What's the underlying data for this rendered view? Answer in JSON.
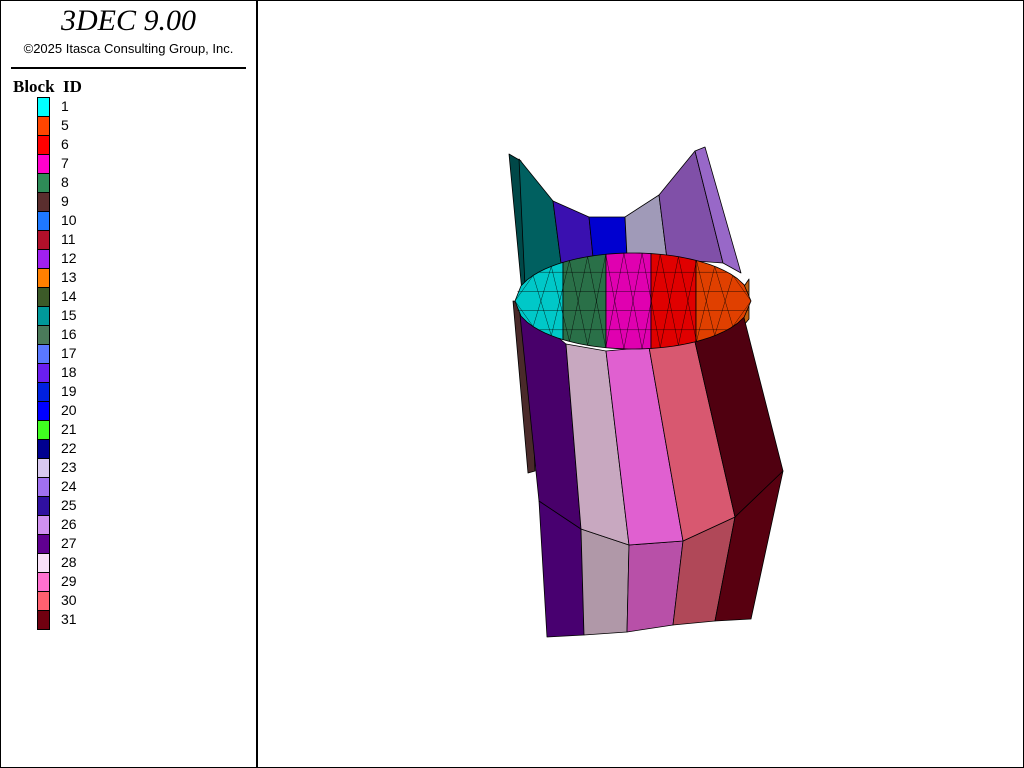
{
  "app": {
    "title": "3DEC 9.00",
    "copyright": "©2025 Itasca Consulting Group, Inc."
  },
  "legend": {
    "title": "Block  ID",
    "items": [
      {
        "label": "1",
        "color": "#00ffff"
      },
      {
        "label": "5",
        "color": "#ff4500"
      },
      {
        "label": "6",
        "color": "#ff0000"
      },
      {
        "label": "7",
        "color": "#ff00cc"
      },
      {
        "label": "8",
        "color": "#2e8b57"
      },
      {
        "label": "9",
        "color": "#5a2e2e"
      },
      {
        "label": "10",
        "color": "#1e78ff"
      },
      {
        "label": "11",
        "color": "#b0102a"
      },
      {
        "label": "12",
        "color": "#a020f0"
      },
      {
        "label": "13",
        "color": "#ff8000"
      },
      {
        "label": "14",
        "color": "#3c5a28"
      },
      {
        "label": "15",
        "color": "#00999a"
      },
      {
        "label": "16",
        "color": "#4a7a5a"
      },
      {
        "label": "17",
        "color": "#5a78ff"
      },
      {
        "label": "18",
        "color": "#6a1ef0"
      },
      {
        "label": "19",
        "color": "#0020e0"
      },
      {
        "label": "20",
        "color": "#0000ff"
      },
      {
        "label": "21",
        "color": "#40ff20"
      },
      {
        "label": "22",
        "color": "#000090"
      },
      {
        "label": "23",
        "color": "#d8c8f0"
      },
      {
        "label": "24",
        "color": "#a070f0"
      },
      {
        "label": "25",
        "color": "#3010a0"
      },
      {
        "label": "26",
        "color": "#d090f0"
      },
      {
        "label": "27",
        "color": "#600090"
      },
      {
        "label": "28",
        "color": "#f8e0f8"
      },
      {
        "label": "29",
        "color": "#ff70d0"
      },
      {
        "label": "30",
        "color": "#ff6070"
      },
      {
        "label": "31",
        "color": "#700010"
      }
    ]
  },
  "model": {
    "back_panels": [
      {
        "block": "15",
        "color": "#006060"
      },
      {
        "block": "18",
        "color": "#3a10b0"
      },
      {
        "block": "20",
        "color": "#0000d0"
      },
      {
        "block": "23",
        "color": "#a09ab8"
      },
      {
        "block": "24",
        "color": "#8050a8"
      },
      {
        "block": "24",
        "color": "#9868c8"
      }
    ],
    "disc_segments": [
      {
        "block": "1",
        "color": "#00c8c8"
      },
      {
        "block": "8",
        "color": "#2a7048"
      },
      {
        "block": "7",
        "color": "#e000b0"
      },
      {
        "block": "6",
        "color": "#e00000"
      },
      {
        "block": "5",
        "color": "#e04000"
      }
    ],
    "column_faces": [
      {
        "block": "27",
        "color": "#48006a"
      },
      {
        "block": "28",
        "color": "#c8a8c0"
      },
      {
        "block": "29",
        "color": "#e060d0"
      },
      {
        "block": "30",
        "color": "#d85870"
      },
      {
        "block": "31",
        "color": "#500010"
      }
    ],
    "column_lower_faces": [
      {
        "block": "27",
        "color": "#480070"
      },
      {
        "block": "28",
        "color": "#b098a8"
      },
      {
        "block": "29",
        "color": "#b850a8"
      },
      {
        "block": "30",
        "color": "#b04858"
      },
      {
        "block": "31",
        "color": "#580010"
      }
    ]
  }
}
